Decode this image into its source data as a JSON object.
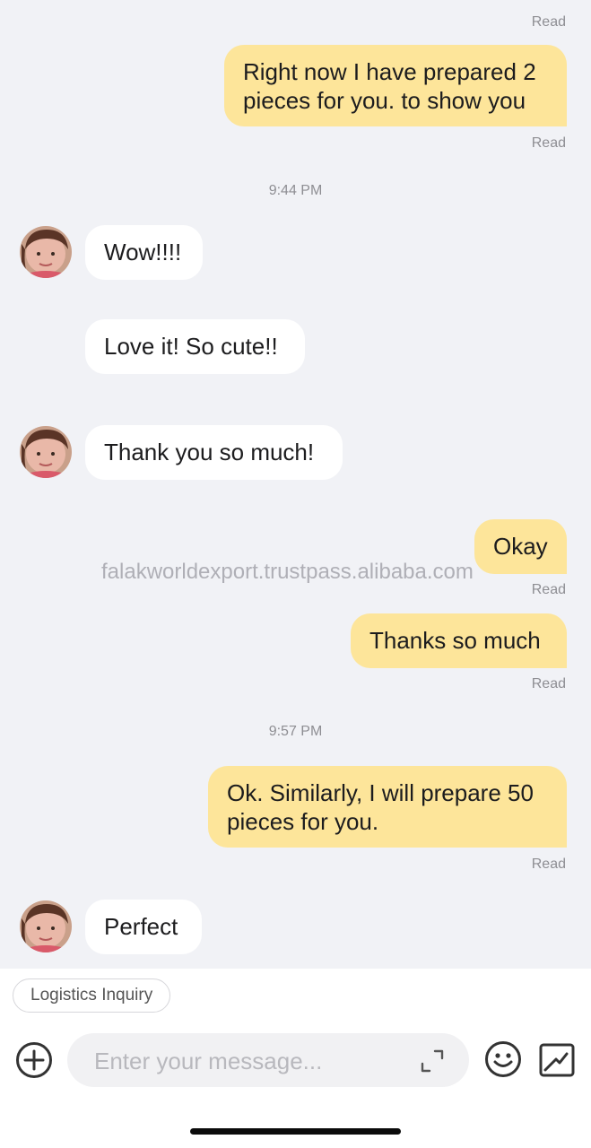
{
  "messages": {
    "read_1": "Read",
    "out_1_line1": "Right now I have prepared 2",
    "out_1_line2": "pieces for you. to show you",
    "read_2": "Read",
    "time_1": "9:44 PM",
    "in_1": "Wow!!!!",
    "in_2": "Love it! So cute!!",
    "in_3": "Thank you so much!",
    "out_2": "Okay",
    "read_3": "Read",
    "out_3": "Thanks so much",
    "read_4": "Read",
    "time_2": "9:57 PM",
    "out_4_line1": "Ok. Similarly, I will prepare 50",
    "out_4_line2": "pieces for you.",
    "read_5": "Read",
    "in_4": "Perfect"
  },
  "watermark": "falakworldexport.trustpass.alibaba.com",
  "quick_reply": {
    "label": "Logistics Inquiry"
  },
  "composer": {
    "placeholder": "Enter your message...",
    "icons": {
      "add": "plus-circle-icon",
      "expand": "expand-icon",
      "emoji": "smiley-icon",
      "image": "image-icon"
    }
  },
  "colors": {
    "chat_background": "#f1f2f6",
    "outgoing_bubble": "#fde59a",
    "incoming_bubble": "#ffffff",
    "meta_text": "#8e8e93"
  }
}
